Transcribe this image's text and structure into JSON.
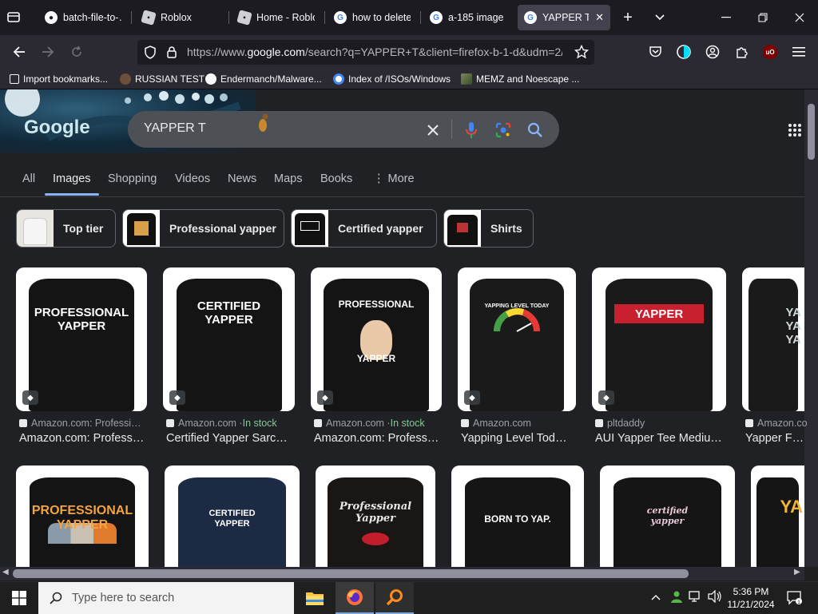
{
  "tabs": [
    {
      "title": "batch-file-to-…",
      "icon": "github-icon",
      "active": false
    },
    {
      "title": "Roblox",
      "icon": "roblox-icon",
      "active": false
    },
    {
      "title": "Home - Roblo",
      "icon": "roblox-icon",
      "active": false
    },
    {
      "title": "how to delete",
      "icon": "google-icon",
      "active": false
    },
    {
      "title": "a-185 image -",
      "icon": "google-icon",
      "active": false
    },
    {
      "title": "YAPPER T -",
      "icon": "google-icon",
      "active": true
    }
  ],
  "new_tab_label": "+",
  "url": {
    "prefix": "https://www.",
    "host": "google.com",
    "rest": "/search?q=YAPPER+T&client=firefox-b-1-d&udm=2/"
  },
  "bookmarks": [
    {
      "label": "Import bookmarks...",
      "icon": "import-icon"
    },
    {
      "label": "RUSSIAN TEST",
      "icon": "snail-icon"
    },
    {
      "label": "Endermanch/Malware...",
      "icon": "github-icon"
    },
    {
      "label": "Index of /ISOs/Windows",
      "icon": "google-icon"
    },
    {
      "label": "MEMZ and Noescape ...",
      "icon": "image-icon"
    }
  ],
  "logo_text": "Google",
  "search_query": "YAPPER T",
  "search_nav": [
    {
      "label": "All",
      "active": false
    },
    {
      "label": "Images",
      "active": true
    },
    {
      "label": "Shopping",
      "active": false
    },
    {
      "label": "Videos",
      "active": false
    },
    {
      "label": "News",
      "active": false
    },
    {
      "label": "Maps",
      "active": false
    },
    {
      "label": "Books",
      "active": false
    },
    {
      "label": "⋮ More",
      "active": false
    }
  ],
  "chips": [
    {
      "label": "Top tier"
    },
    {
      "label": "Professional yapper"
    },
    {
      "label": "Certified yapper"
    },
    {
      "label": "Shirts"
    }
  ],
  "results_row1": [
    {
      "shirt_text": "PROFESSIONAL\nYAPPER",
      "source": "Amazon.com: Professi…",
      "stock": "",
      "caption": "Amazon.com: Profess…",
      "shirt_color": "#141414",
      "bg": "#ffffff"
    },
    {
      "shirt_text": "CERTIFIED\nYAPPER",
      "source": "Amazon.com · ",
      "stock": "In stock",
      "caption": "Certified Yapper Sarc…",
      "shirt_color": "#141414",
      "bg": "#ffffff"
    },
    {
      "shirt_text": "PROFESSIONAL\n\n\n\nYAPPER",
      "source": "Amazon.com · ",
      "stock": "In stock",
      "caption": "Amazon.com: Profess…",
      "shirt_color": "#141414",
      "bg": "#ffffff"
    },
    {
      "shirt_text": "YAPPING LEVEL TODAY",
      "source": "Amazon.com",
      "stock": "",
      "caption": "Yapping Level Tod…",
      "shirt_color": "#1a1a1a",
      "bg": "#ffffff"
    },
    {
      "shirt_text": "YAPPER",
      "source": "pltdaddy",
      "stock": "",
      "caption": "AUI Yapper Tee Mediu…",
      "shirt_color": "#1a1a1a",
      "bg": "#ffffff"
    },
    {
      "shirt_text": "YA\nYA\nYA",
      "source": "Amazon.com",
      "stock": "",
      "caption": "Yapper Fun",
      "shirt_color": "#1a1a1a",
      "bg": "#ffffff"
    }
  ],
  "results_row2": [
    {
      "shirt_text": "PROFESSIONAL\nYAPPER",
      "shirt_color": "#141414"
    },
    {
      "shirt_text": "CERTIFIED\nYAPPER",
      "shirt_color": "#1c2a44"
    },
    {
      "shirt_text": "Professional\nYapper",
      "shirt_color": "#1a1614"
    },
    {
      "shirt_text": "BORN TO YAP.",
      "shirt_color": "#151515"
    },
    {
      "shirt_text": "certified\nyapper",
      "shirt_color": "#151515"
    },
    {
      "shirt_text": "YA",
      "shirt_color": "#151515"
    }
  ],
  "taskbar": {
    "search_placeholder": "Type here to search",
    "time": "5:36 PM",
    "date": "11/21/2024"
  },
  "colors": {
    "accent": "#8ab4f8",
    "in_stock": "#81c995"
  }
}
